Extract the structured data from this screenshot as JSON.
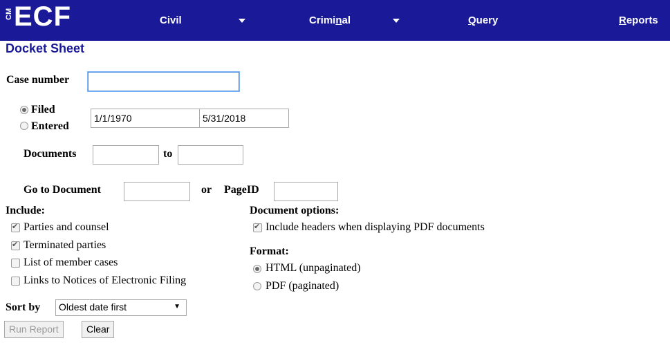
{
  "nav": {
    "logo_cm": "CM",
    "logo_ecf": "ECF",
    "civil": "Civil",
    "criminal_pre": "Crimi",
    "criminal_u": "n",
    "criminal_post": "al",
    "query_u": "Q",
    "query_post": "uery",
    "reports_u": "R",
    "reports_post": "eports"
  },
  "page_title": "Docket Sheet",
  "case_number": {
    "label": "Case number",
    "value": ""
  },
  "date_filter": {
    "filed_label": "Filed",
    "entered_label": "Entered",
    "selected": "Filed",
    "from": "1/1/1970",
    "to_label": "to",
    "to": "5/31/2018"
  },
  "documents": {
    "label": "Documents",
    "to_label": "to",
    "from": "",
    "to": ""
  },
  "goto": {
    "label": "Go to Document",
    "or_label": "or",
    "pageid_label": "PageID",
    "doc": "",
    "pageid": ""
  },
  "include": {
    "heading": "Include:",
    "items": [
      {
        "label": "Parties and counsel",
        "checked": true
      },
      {
        "label": "Terminated parties",
        "checked": true
      },
      {
        "label": "List of member cases",
        "checked": false
      },
      {
        "label": "Links to Notices of Electronic Filing",
        "checked": false
      }
    ]
  },
  "doc_options": {
    "heading": "Document options:",
    "headers_label": "Include headers when displaying PDF documents",
    "headers_checked": true
  },
  "format": {
    "heading": "Format:",
    "html_label": "HTML (unpaginated)",
    "pdf_label": "PDF (paginated)",
    "selected": "HTML"
  },
  "sort": {
    "label": "Sort by",
    "value": "Oldest date first"
  },
  "buttons": {
    "run": "Run Report",
    "clear": "Clear"
  },
  "colors": {
    "nav_bg": "#1a1a99",
    "title": "#1a1a99"
  }
}
